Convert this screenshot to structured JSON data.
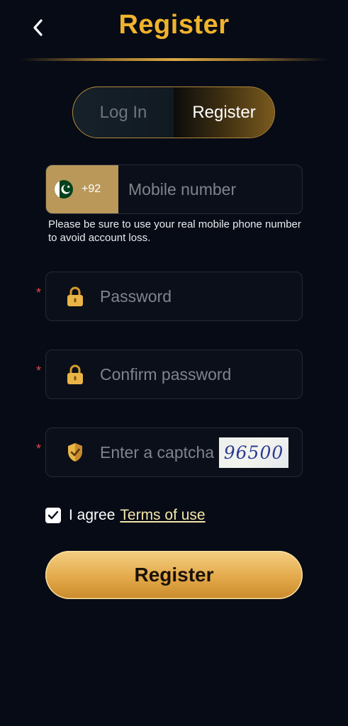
{
  "header": {
    "title": "Register",
    "back_icon": "chevron-left-icon"
  },
  "tabs": [
    {
      "label": "Log In",
      "active": false
    },
    {
      "label": "Register",
      "active": true
    }
  ],
  "phone": {
    "country_flag": "pakistan-flag-icon",
    "dial_code": "+92",
    "placeholder": "Mobile number",
    "value": "",
    "hint": "Please be sure to use your real mobile phone number to avoid account loss."
  },
  "password": {
    "required_mark": "*",
    "icon": "lock-icon",
    "placeholder": "Password",
    "value": ""
  },
  "confirm_password": {
    "required_mark": "*",
    "icon": "lock-icon",
    "placeholder": "Confirm password",
    "value": ""
  },
  "captcha": {
    "required_mark": "*",
    "icon": "shield-check-icon",
    "placeholder": "Enter a captcha",
    "value": "",
    "image_code": "96500"
  },
  "agreement": {
    "checked": true,
    "text": "I agree",
    "link_text": "Terms of use"
  },
  "submit": {
    "label": "Register"
  },
  "colors": {
    "background": "#070b16",
    "accent_gold": "#f0b32c",
    "button_gold": "#e3a94a",
    "required_red": "#e24a4a",
    "country_bg": "#b9985a"
  }
}
